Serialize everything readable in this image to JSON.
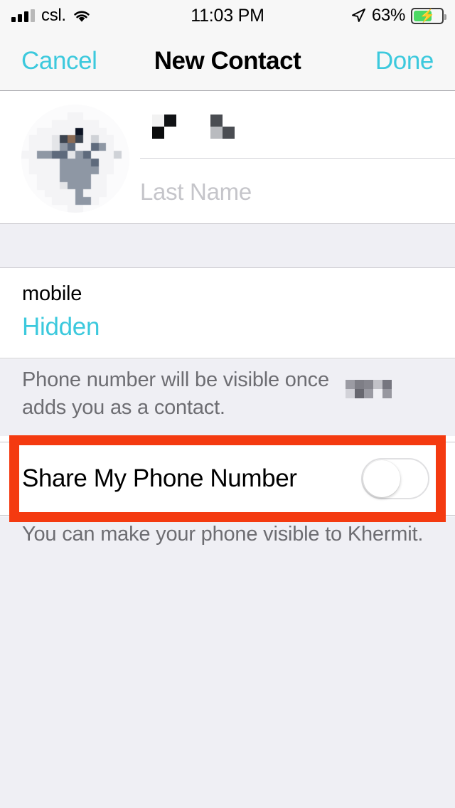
{
  "status_bar": {
    "carrier": "csl.",
    "time": "11:03 PM",
    "battery_percent": "63%",
    "battery_level": 63,
    "charging": true,
    "signal_bars_filled": 3,
    "signal_bars_total": 4,
    "icons": [
      "signal-bars-icon",
      "wifi-icon",
      "location-arrow-icon",
      "battery-charging-icon"
    ]
  },
  "nav_bar": {
    "cancel_label": "Cancel",
    "title": "New Contact",
    "done_label": "Done"
  },
  "name_section": {
    "avatar_alt": "contact-photo-pixelated",
    "first_name_value": "",
    "first_name_redacted": true,
    "last_name_placeholder": "Last Name",
    "last_name_value": ""
  },
  "phone_section": {
    "label": "mobile",
    "value": "Hidden"
  },
  "notes": {
    "phone_visibility_note_part1": "Phone number will be visible once",
    "phone_visibility_note_redacted": true,
    "phone_visibility_note_part2": "adds you as a contact.",
    "share_note": "You can make your phone visible to Khermit."
  },
  "toggle_row": {
    "label": "Share My Phone Number",
    "state": "off",
    "highlighted": true
  },
  "colors": {
    "accent_cyan": "#3cc9dd",
    "highlight_orange": "#f43a10",
    "group_background": "#efeff4",
    "cell_background": "#ffffff",
    "separator": "#c8c7cc",
    "secondary_text": "#6d6d72",
    "placeholder_text": "#c5c5ca",
    "battery_green": "#4cd964"
  }
}
